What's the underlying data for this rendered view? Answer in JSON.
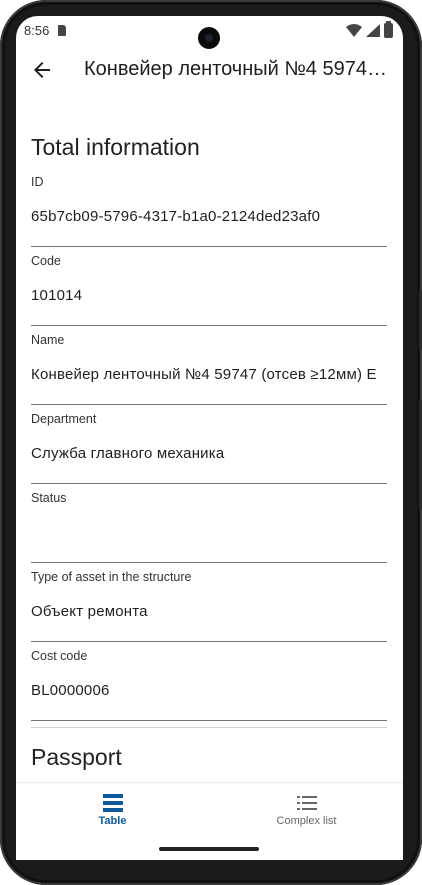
{
  "status_bar": {
    "time": "8:56"
  },
  "app_bar": {
    "title": "Конвейер ленточный №4 59747 (отсев ≥12мм) Е"
  },
  "sections": {
    "total": "Total information",
    "passport": "Passport"
  },
  "fields": [
    {
      "label": "ID",
      "value": "65b7cb09-5796-4317-b1a0-2124ded23af0"
    },
    {
      "label": "Code",
      "value": "101014"
    },
    {
      "label": "Name",
      "value": "Конвейер ленточный №4 59747 (отсев ≥12мм) Е"
    },
    {
      "label": "Department",
      "value": "Служба главного механика"
    },
    {
      "label": "Status",
      "value": ""
    },
    {
      "label": "Type of asset in the structure",
      "value": "Объект ремонта"
    },
    {
      "label": "Cost code",
      "value": "BL0000006"
    }
  ],
  "bottom_nav": {
    "items": [
      {
        "label": "Table",
        "icon": "table-icon",
        "selected": true
      },
      {
        "label": "Complex list",
        "icon": "list-icon",
        "selected": false
      }
    ]
  },
  "colors": {
    "accent": "#0d5a9c",
    "text": "#1f1f1f",
    "underline": "#757575"
  }
}
